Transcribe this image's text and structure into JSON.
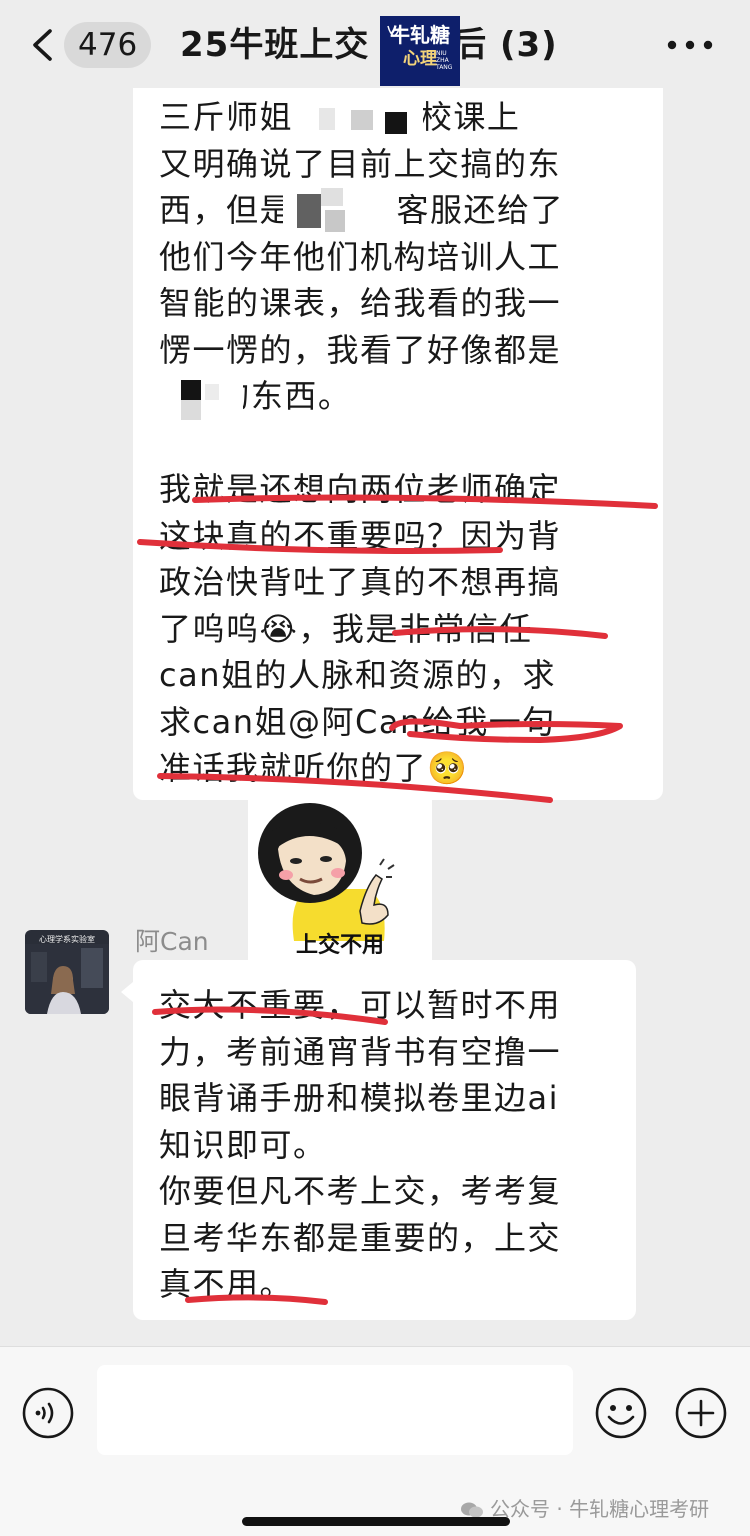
{
  "header": {
    "unread_count": "476",
    "chat_title": "25牛班上交  上岸后 (3)",
    "logo": {
      "line1": "牛轧糖",
      "line2": "心理",
      "line3": "NIU ZHA TANG"
    }
  },
  "messages": [
    {
      "text": "三斤师姐        院校课上\n又明确说了目前上交搞的东\n西，但是      的客服还给了\n他们今年他们机构培训人工\n智能的课表，给我看的我一\n愣一愣的，我看了好像都是\n     的东西。\n\n我就是还想向两位老师确定\n这块真的不重要吗？因为背\n政治快背吐了真的不想再搞\n了呜呜😭，我是非常信任\ncan姐的人脉和资源的，求\n求can姐@阿Can给我一句\n准话我就听你的了🥺"
    },
    {
      "sticker_caption": "上交不用"
    },
    {
      "sender": "阿Can",
      "avatar_label": "心理学系实验室",
      "text": "交大不重要，可以暂时不用\n力，考前通宵背书有空撸一\n眼背诵手册和模拟卷里边ai\n知识即可。\n你要但凡不考上交，考考复\n旦考华东都是重要的，上交\n真不用。"
    }
  ],
  "input": {
    "placeholder": "",
    "value": ""
  },
  "watermark": "公众号 · 牛轧糖心理考研",
  "colors": {
    "background": "#ededed",
    "bubble": "#ffffff",
    "underline": "#e0303a",
    "logo_bg": "#0e1f6b"
  },
  "icons": [
    "back-arrow",
    "more-dots",
    "voice",
    "emoji-face",
    "plus-circle",
    "wechat-logo"
  ]
}
